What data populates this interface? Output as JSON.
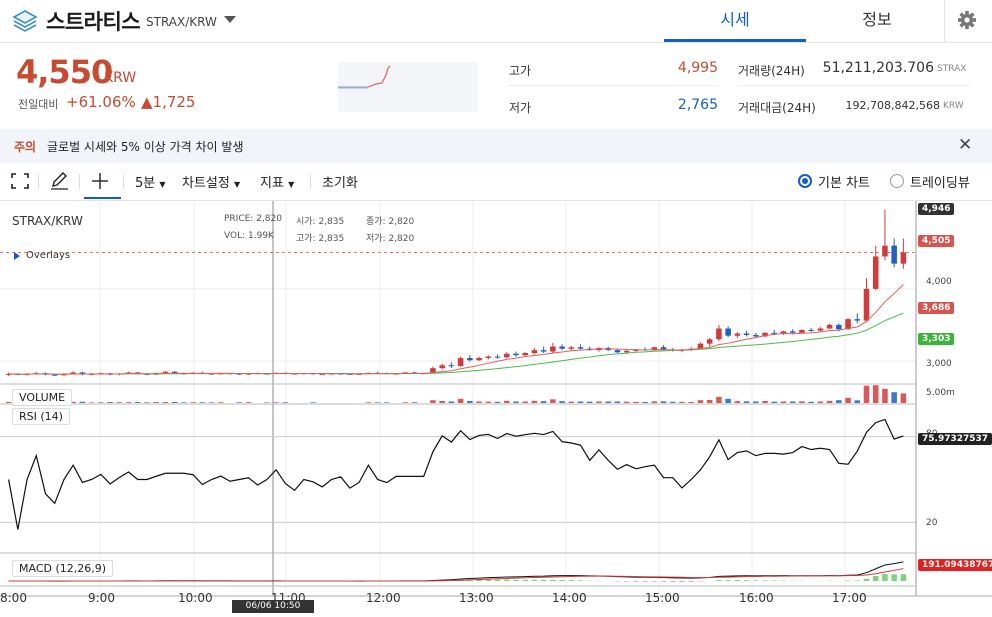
{
  "header": {
    "coin_name": "스트라티스",
    "pair": "STRAX/KRW",
    "tabs": [
      {
        "label": "시세"
      },
      {
        "label": "정보"
      }
    ],
    "icons": {
      "logo": "stratis-logo-icon",
      "dropdown": "chevron-down-icon",
      "settings": "gear-icon"
    }
  },
  "price": {
    "current": "4,550",
    "unit": "KRW",
    "change_label": "전일대비",
    "change_rate": "+61.06%",
    "change_amount": "▲1,725"
  },
  "stats": {
    "high_label": "고가",
    "high_value": "4,995",
    "low_label": "저가",
    "low_value": "2,765",
    "volume_label": "거래량(24H)",
    "volume_value": "51,211,203.706",
    "volume_unit": "STRAX",
    "amount_label": "거래대금(24H)",
    "amount_value": "192,708,842,568",
    "amount_unit": "KRW"
  },
  "notice": {
    "tag": "주의",
    "text": "글로벌 시세와 5% 이상 가격 차이 발생",
    "close": "✕"
  },
  "toolbar": {
    "interval": "5분",
    "chart_settings": "차트설정",
    "indicators": "지표",
    "reset": "초기화",
    "basic_chart": "기본 차트",
    "tradingview": "트레이딩뷰"
  },
  "chart_data": {
    "type": "candlestick",
    "symbol": "STRAX/KRW",
    "info": {
      "price_label": "PRICE:",
      "price": "2,820",
      "open_label": "시가:",
      "open": "2,835",
      "close_label": "종가:",
      "close": "2,820",
      "vol_label": "VOL:",
      "vol": "1.99K",
      "high_label": "고가:",
      "high": "2,835",
      "low_label": "저가:",
      "low": "2,820"
    },
    "overlays_label": "Overlays",
    "price_ticks": [
      "4,000",
      "3,000"
    ],
    "price_tags": {
      "high": "4,946",
      "last": "4,505",
      "ma_red": "3,686",
      "ma_green": "3,303"
    },
    "price_range": [
      2680,
      5150
    ],
    "volume_label": "VOLUME",
    "volume_tick": "5.00m",
    "rsi_label": "RSI (14)",
    "rsi_ticks": [
      "80",
      "20"
    ],
    "rsi_value": "75.97327537",
    "macd_label": "MACD (12,26,9)",
    "macd_value": "191.09438767",
    "x_labels": [
      "8:00",
      "9:00",
      "10:00",
      "11:00",
      "12:00",
      "13:00",
      "14:00",
      "15:00",
      "16:00",
      "17:00"
    ],
    "cursor_time": "06/06 10:50",
    "candles": [
      [
        2810,
        2840,
        2790,
        2820
      ],
      [
        2820,
        2830,
        2800,
        2810
      ],
      [
        2810,
        2830,
        2795,
        2820
      ],
      [
        2820,
        2850,
        2810,
        2830
      ],
      [
        2830,
        2840,
        2800,
        2810
      ],
      [
        2810,
        2825,
        2790,
        2800
      ],
      [
        2800,
        2830,
        2795,
        2820
      ],
      [
        2820,
        2860,
        2810,
        2840
      ],
      [
        2840,
        2850,
        2800,
        2815
      ],
      [
        2815,
        2830,
        2800,
        2820
      ],
      [
        2820,
        2840,
        2810,
        2830
      ],
      [
        2830,
        2835,
        2800,
        2810
      ],
      [
        2810,
        2830,
        2800,
        2825
      ],
      [
        2825,
        2850,
        2815,
        2840
      ],
      [
        2840,
        2845,
        2810,
        2820
      ],
      [
        2820,
        2830,
        2800,
        2810
      ],
      [
        2810,
        2840,
        2805,
        2830
      ],
      [
        2830,
        2860,
        2820,
        2850
      ],
      [
        2850,
        2860,
        2820,
        2830
      ],
      [
        2830,
        2840,
        2810,
        2820
      ],
      [
        2820,
        2845,
        2815,
        2835
      ],
      [
        2835,
        2850,
        2820,
        2825
      ],
      [
        2825,
        2830,
        2805,
        2815
      ],
      [
        2815,
        2840,
        2810,
        2830
      ],
      [
        2830,
        2835,
        2815,
        2825
      ],
      [
        2825,
        2830,
        2805,
        2810
      ],
      [
        2810,
        2835,
        2805,
        2830
      ],
      [
        2830,
        2840,
        2820,
        2825
      ],
      [
        2825,
        2835,
        2810,
        2820
      ],
      [
        2820,
        2840,
        2815,
        2835
      ],
      [
        2835,
        2840,
        2815,
        2820
      ],
      [
        2820,
        2830,
        2810,
        2825
      ],
      [
        2825,
        2835,
        2815,
        2830
      ],
      [
        2830,
        2835,
        2810,
        2815
      ],
      [
        2815,
        2830,
        2810,
        2820
      ],
      [
        2820,
        2830,
        2815,
        2825
      ],
      [
        2825,
        2835,
        2815,
        2820
      ],
      [
        2820,
        2830,
        2810,
        2815
      ],
      [
        2815,
        2825,
        2810,
        2820
      ],
      [
        2820,
        2840,
        2815,
        2835
      ],
      [
        2835,
        2850,
        2820,
        2830
      ],
      [
        2830,
        2840,
        2815,
        2820
      ],
      [
        2820,
        2830,
        2810,
        2825
      ],
      [
        2825,
        2845,
        2820,
        2840
      ],
      [
        2840,
        2850,
        2820,
        2825
      ],
      [
        2825,
        2835,
        2815,
        2830
      ],
      [
        2830,
        2920,
        2825,
        2900
      ],
      [
        2900,
        2960,
        2880,
        2940
      ],
      [
        2940,
        2980,
        2900,
        2930
      ],
      [
        2930,
        3060,
        2920,
        3040
      ],
      [
        3040,
        3080,
        2990,
        3010
      ],
      [
        3010,
        3060,
        3000,
        3040
      ],
      [
        3040,
        3080,
        3020,
        3060
      ],
      [
        3060,
        3090,
        3030,
        3050
      ],
      [
        3050,
        3120,
        3040,
        3100
      ],
      [
        3100,
        3130,
        3060,
        3080
      ],
      [
        3080,
        3120,
        3060,
        3110
      ],
      [
        3110,
        3180,
        3090,
        3150
      ],
      [
        3150,
        3200,
        3110,
        3130
      ],
      [
        3130,
        3250,
        3100,
        3200
      ],
      [
        3200,
        3230,
        3150,
        3170
      ],
      [
        3170,
        3210,
        3150,
        3190
      ],
      [
        3190,
        3230,
        3160,
        3170
      ],
      [
        3170,
        3200,
        3140,
        3150
      ],
      [
        3150,
        3190,
        3130,
        3180
      ],
      [
        3180,
        3200,
        3140,
        3150
      ],
      [
        3150,
        3170,
        3110,
        3120
      ],
      [
        3120,
        3160,
        3100,
        3140
      ],
      [
        3140,
        3170,
        3120,
        3160
      ],
      [
        3160,
        3190,
        3140,
        3150
      ],
      [
        3150,
        3200,
        3140,
        3190
      ],
      [
        3190,
        3220,
        3150,
        3160
      ],
      [
        3160,
        3180,
        3130,
        3140
      ],
      [
        3140,
        3170,
        3120,
        3160
      ],
      [
        3160,
        3190,
        3140,
        3170
      ],
      [
        3170,
        3260,
        3160,
        3240
      ],
      [
        3240,
        3320,
        3200,
        3300
      ],
      [
        3300,
        3500,
        3280,
        3450
      ],
      [
        3450,
        3480,
        3330,
        3350
      ],
      [
        3350,
        3400,
        3320,
        3380
      ],
      [
        3380,
        3420,
        3340,
        3360
      ],
      [
        3360,
        3390,
        3320,
        3340
      ],
      [
        3340,
        3400,
        3330,
        3390
      ],
      [
        3390,
        3430,
        3360,
        3380
      ],
      [
        3380,
        3420,
        3360,
        3410
      ],
      [
        3410,
        3440,
        3370,
        3390
      ],
      [
        3390,
        3440,
        3380,
        3430
      ],
      [
        3430,
        3460,
        3400,
        3420
      ],
      [
        3420,
        3470,
        3410,
        3450
      ],
      [
        3450,
        3520,
        3440,
        3500
      ],
      [
        3500,
        3520,
        3410,
        3440
      ],
      [
        3440,
        3600,
        3430,
        3580
      ],
      [
        3580,
        3660,
        3520,
        3560
      ],
      [
        3560,
        4150,
        3550,
        4000
      ],
      [
        4000,
        4600,
        3980,
        4450
      ],
      [
        4450,
        5100,
        4400,
        4600
      ],
      [
        4600,
        4700,
        4300,
        4350
      ],
      [
        4350,
        4700,
        4280,
        4505
      ]
    ]
  }
}
